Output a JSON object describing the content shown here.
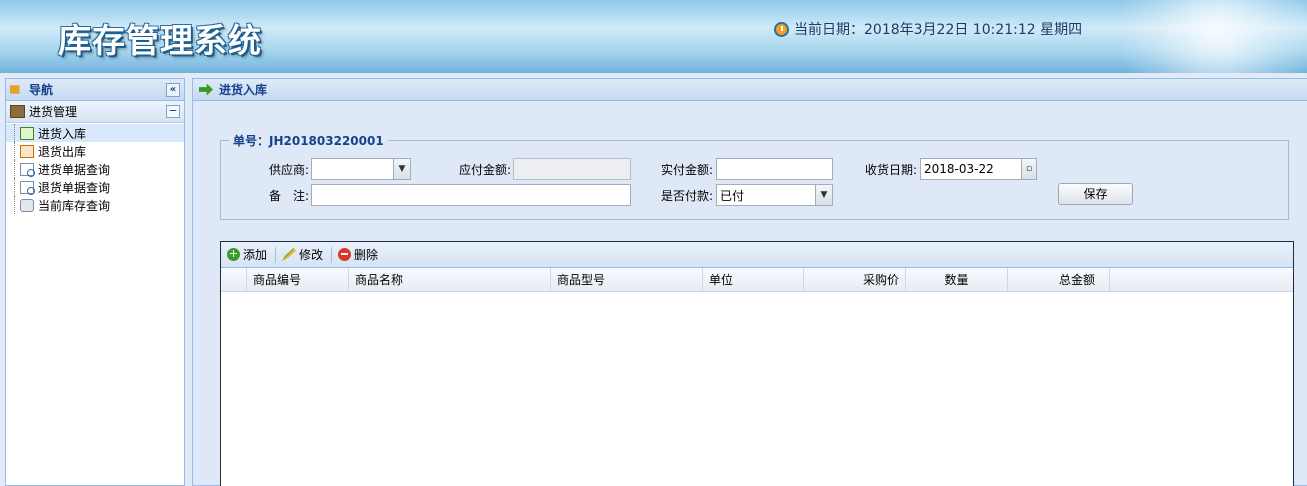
{
  "header": {
    "app_title": "库存管理系统",
    "date_label": "当前日期：",
    "date_value": "2018年3月22日 10:21:12 星期四"
  },
  "sidebar": {
    "title": "导航",
    "collapse_glyph": "«",
    "section": {
      "title": "进货管理",
      "toggle_glyph": "−",
      "items": [
        {
          "label": "进货入库",
          "icon": "arrow-right-icon"
        },
        {
          "label": "退货出库",
          "icon": "arrow-left-icon"
        },
        {
          "label": "进货单据查询",
          "icon": "document-search-icon"
        },
        {
          "label": "退货单据查询",
          "icon": "document-search-icon"
        },
        {
          "label": "当前库存查询",
          "icon": "database-icon"
        }
      ]
    }
  },
  "main": {
    "panel_title": "进货入库",
    "form": {
      "legend": "单号：JH201803220001",
      "supplier_label": "供应商:",
      "supplier_value": "",
      "payable_label": "应付金额:",
      "payable_value": "",
      "actual_label": "实付金额:",
      "actual_value": "",
      "date_label": "收货日期:",
      "date_value": "2018-03-22",
      "remark_label": "备　注:",
      "remark_value": "",
      "paid_label": "是否付款:",
      "paid_value": "已付",
      "save_label": "保存"
    },
    "grid": {
      "toolbar": {
        "add": "添加",
        "edit": "修改",
        "delete": "删除"
      },
      "columns": [
        "商品编号",
        "商品名称",
        "商品型号",
        "单位",
        "采购价",
        "数量",
        "总金额"
      ],
      "rows": []
    }
  },
  "colors": {
    "accent": "#15428b",
    "border": "#99bbe8",
    "background": "#dfe8f6"
  }
}
